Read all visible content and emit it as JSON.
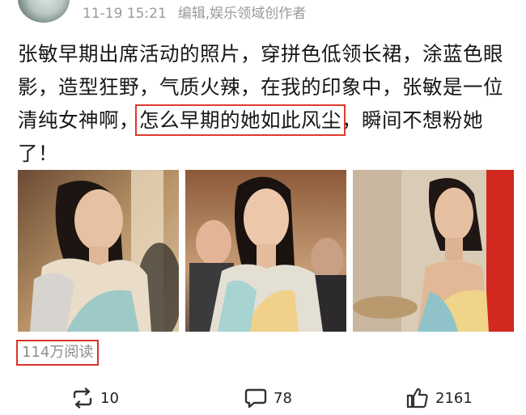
{
  "post": {
    "time": "11-19 15:21",
    "source": "编辑,娱乐领域创作者",
    "text_part1": "张敏早期出席活动的照片，穿拼色低领长裙，涂蓝色眼影，造型狂野，气质火辣，在我的印象中，张敏是一位清纯女神啊，",
    "text_highlight": "怎么早期的她如此风尘",
    "text_part2": "，瞬间不想粉她了！",
    "reads": "114万阅读"
  },
  "actions": {
    "repost_count": "10",
    "comment_count": "78",
    "like_count": "2161"
  },
  "icons": [
    "avatar",
    "repost-icon",
    "comment-icon",
    "like-icon"
  ],
  "colors": {
    "highlight_border": "#e0392f",
    "meta_text": "#9a9a9a"
  }
}
